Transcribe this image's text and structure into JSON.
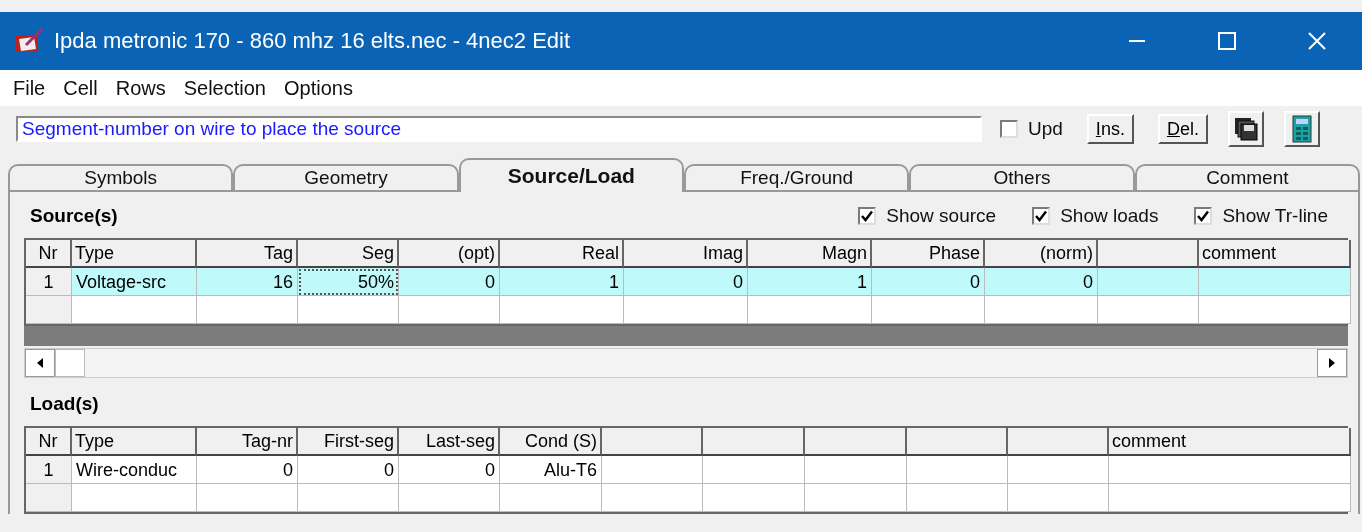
{
  "window": {
    "title": "Ipda metronic 170 - 860 mhz 16 elts.nec - 4nec2 Edit"
  },
  "menu": [
    "File",
    "Cell",
    "Rows",
    "Selection",
    "Options"
  ],
  "toolbar": {
    "hint_field": {
      "value": "Segment-number on wire to place the source"
    },
    "upd": {
      "label": "Upd",
      "checked": false
    },
    "buttons": [
      "Ins.",
      "Del."
    ]
  },
  "tabs": [
    {
      "label": "Symbols",
      "selected": false
    },
    {
      "label": "Geometry",
      "selected": false
    },
    {
      "label": "Source/Load",
      "selected": true
    },
    {
      "label": "Freq./Ground",
      "selected": false
    },
    {
      "label": "Others",
      "selected": false
    },
    {
      "label": "Comment",
      "selected": false
    }
  ],
  "sources": {
    "title": "Source(s)",
    "options": [
      {
        "label": "Show source",
        "checked": true
      },
      {
        "label": "Show loads",
        "checked": true
      },
      {
        "label": "Show Tr-line",
        "checked": true
      }
    ],
    "columns": [
      "Nr",
      "Type",
      "Tag",
      "Seg",
      "(opt)",
      "Real",
      "Imag",
      "Magn",
      "Phase",
      "(norm)",
      null,
      "comment"
    ],
    "rows": [
      {
        "cells": [
          {
            "text": "1",
            "focused": false
          },
          {
            "text": "Voltage-src",
            "focused": false
          },
          {
            "text": "16",
            "focused": false
          },
          {
            "text": "50%",
            "focused": true
          },
          {
            "text": "0",
            "focused": false
          },
          {
            "text": "1",
            "focused": false
          },
          {
            "text": "0",
            "focused": false
          },
          {
            "text": "1",
            "focused": false
          },
          {
            "text": "0",
            "focused": false
          },
          {
            "text": "0",
            "focused": false
          }
        ],
        "selected": true
      }
    ]
  },
  "loads": {
    "title": "Load(s)",
    "columns": [
      "Nr",
      "Type",
      "Tag-nr",
      "First-seg",
      "Last-seg",
      "Cond (S)",
      null,
      null,
      null,
      null,
      null,
      "comment"
    ],
    "rows": [
      {
        "cells": [
          {
            "text": "1",
            "focused": false
          },
          {
            "text": "Wire-conduc",
            "focused": false
          },
          {
            "text": "0",
            "focused": false
          },
          {
            "text": "0",
            "focused": false
          },
          {
            "text": "0",
            "focused": false
          },
          {
            "text": "Alu-T6",
            "focused": false
          }
        ],
        "selected": false
      }
    ]
  }
}
